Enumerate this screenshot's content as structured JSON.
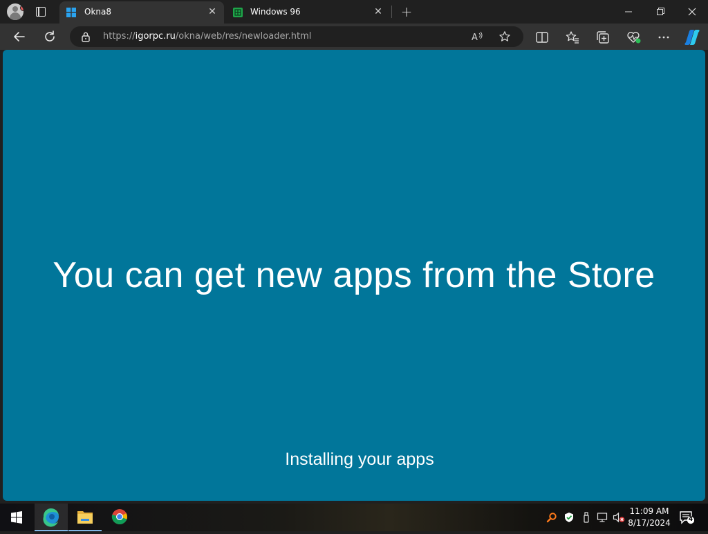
{
  "browser": {
    "tabs": [
      {
        "title": "Okna8",
        "active": true,
        "favicon": "windows-logo-icon"
      },
      {
        "title": "Windows 96",
        "active": false,
        "favicon": "windows96-icon"
      }
    ],
    "url": {
      "scheme": "https://",
      "host": "igorpc.ru",
      "path": "/okna/web/res/newloader.html"
    },
    "icons": {
      "profile": "profile-avatar-icon",
      "tab_actions": "tab-actions-icon",
      "new_tab": "plus-icon",
      "back": "back-arrow-icon",
      "refresh": "refresh-icon",
      "lock": "lock-icon",
      "read_aloud": "read-aloud-icon",
      "favorite": "star-icon",
      "split_screen": "split-screen-icon",
      "favorites": "favorites-icon",
      "collections": "collections-icon",
      "browser_essentials": "browser-essentials-icon",
      "more": "more-icon",
      "copilot": "copilot-icon"
    }
  },
  "page": {
    "headline": "You can get new apps from the Store",
    "status": "Installing your apps",
    "background_color": "#01769a"
  },
  "taskbar": {
    "apps": [
      "start-icon",
      "edge-icon",
      "file-explorer-icon",
      "chrome-icon"
    ],
    "tray": [
      "search-tray-icon",
      "defender-icon",
      "usb-icon",
      "network-icon",
      "volume-muted-icon"
    ],
    "time": "11:09 AM",
    "date": "8/17/2024",
    "notification_count": "4"
  },
  "colors": {
    "tabstrip": "#202020",
    "toolbar": "#333333",
    "accent": "#7fb6e6"
  }
}
